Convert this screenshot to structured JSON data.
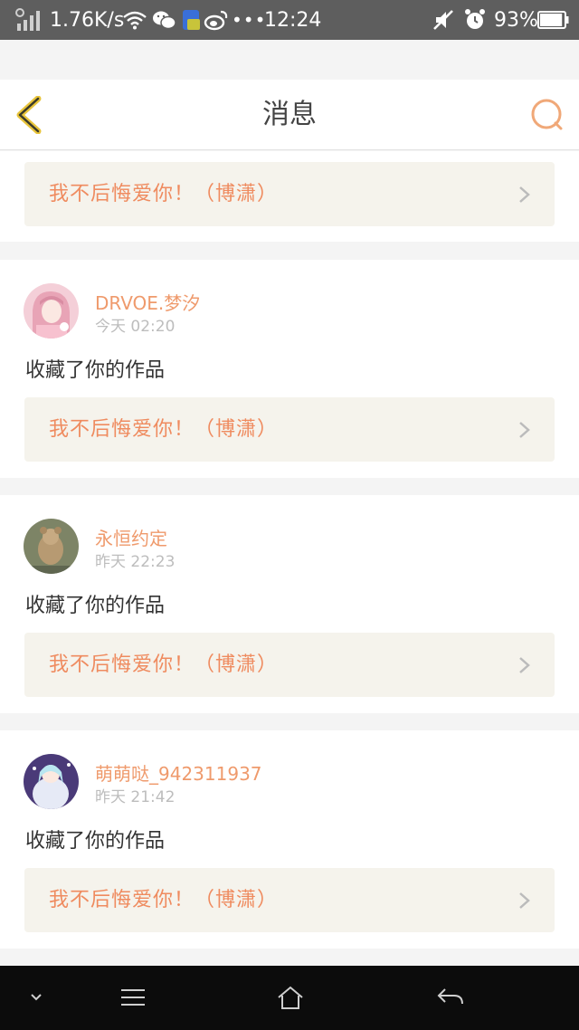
{
  "status_bar": {
    "network_speed": "1.76K/s",
    "time": "12:24",
    "battery_percent": "93%",
    "battery_level": 0.93,
    "more_indicator": "•••"
  },
  "header": {
    "title": "消息"
  },
  "top_card": {
    "work_title": "我不后悔爱你！（博潇）"
  },
  "notifications": [
    {
      "username": "DRVOE.梦汐",
      "time": "今天 02:20",
      "action": "收藏了你的作品",
      "work_title": "我不后悔爱你！（博潇）"
    },
    {
      "username": "永恒约定",
      "time": "昨天 22:23",
      "action": "收藏了你的作品",
      "work_title": "我不后悔爱你！（博潇）"
    },
    {
      "username": "萌萌哒_942311937",
      "time": "昨天 21:42",
      "action": "收藏了你的作品",
      "work_title": "我不后悔爱你！（博潇）"
    }
  ],
  "icons": {
    "back": "back-chevron-icon",
    "search": "search-icon",
    "nav_down": "chevron-down-icon",
    "nav_menu": "menu-icon",
    "nav_home": "home-icon",
    "nav_back": "back-arrow-icon"
  },
  "colors": {
    "accent": "#ef8b5f",
    "username": "#ef9a6c",
    "link_background": "#f5f3ec",
    "back_icon": "#e8c43a",
    "status_bar": "#5e5e5e",
    "nav_bar": "#0c0c0c"
  }
}
